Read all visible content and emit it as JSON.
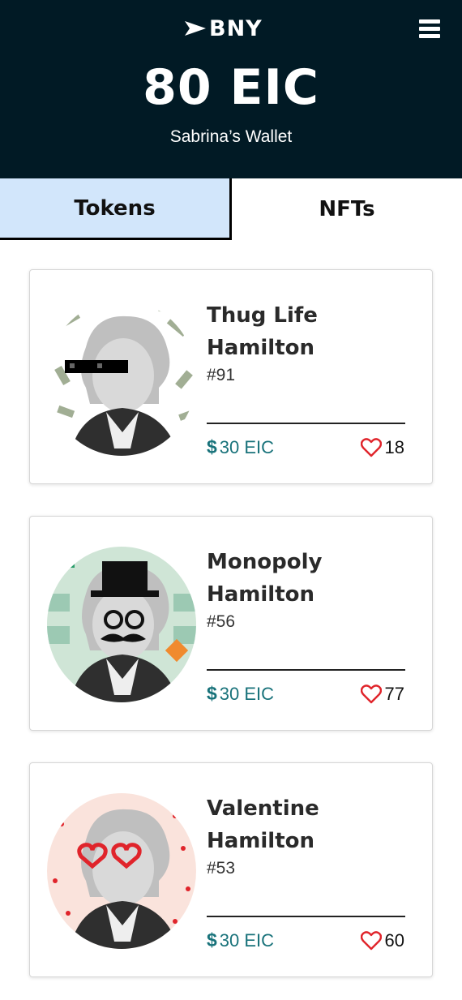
{
  "header": {
    "logo_text": "BNY",
    "balance": "80 EIC",
    "wallet_name": "Sabrina’s Wallet"
  },
  "tabs": [
    {
      "label": "Tokens",
      "active": true
    },
    {
      "label": "NFTs",
      "active": false
    }
  ],
  "nfts": [
    {
      "name_line1": "Thug Life",
      "name_line2": "Hamilton",
      "id": "#91",
      "currency_symbol": "$",
      "price": "30 EIC",
      "likes": "18",
      "theme": "thug-life"
    },
    {
      "name_line1": "Monopoly",
      "name_line2": "Hamilton",
      "id": "#56",
      "currency_symbol": "$",
      "price": "30 EIC",
      "likes": "77",
      "theme": "monopoly"
    },
    {
      "name_line1": "Valentine",
      "name_line2": "Hamilton",
      "id": "#53",
      "currency_symbol": "$",
      "price": "30 EIC",
      "likes": "60",
      "theme": "valentine"
    }
  ],
  "colors": {
    "header_bg": "#011a25",
    "active_tab_bg": "#d2e6fb",
    "price": "#18727a",
    "heart": "#e0242b"
  }
}
